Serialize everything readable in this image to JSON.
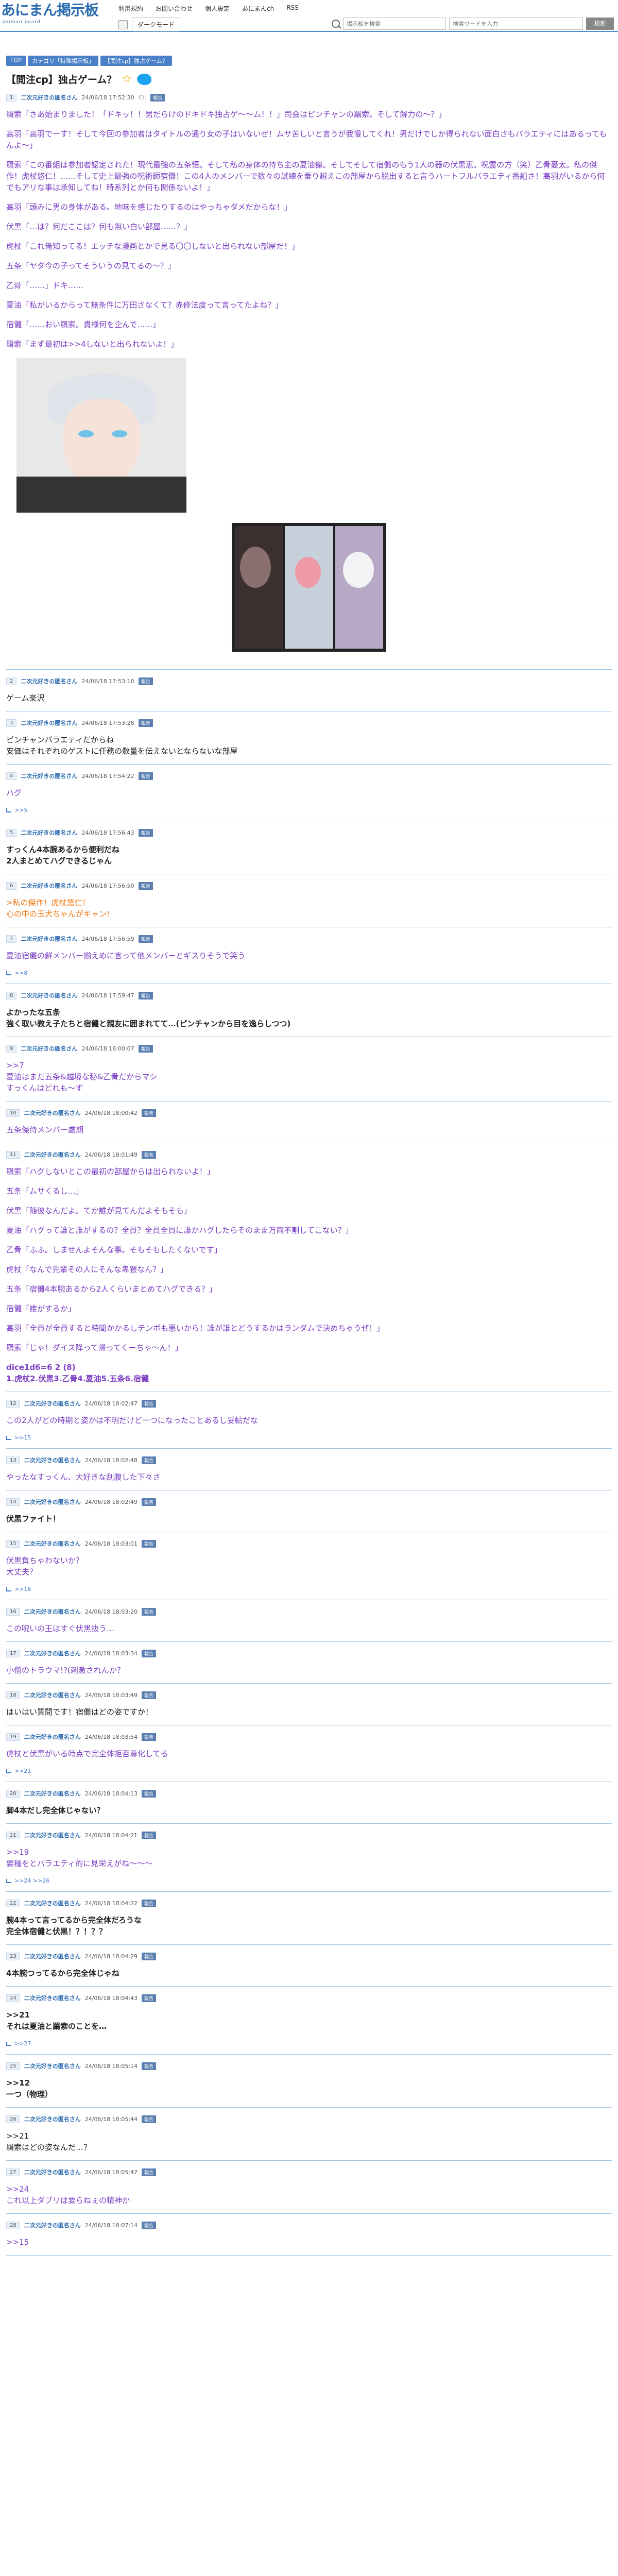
{
  "header": {
    "logo_text": "あにまん掲示板",
    "logo_sub": "animan board",
    "nav": [
      "利用規約",
      "お問い合わせ",
      "個人設定",
      "あにまんch",
      "RSS"
    ],
    "mode_label": "ダークモード",
    "search_placeholder": "掲示板を検索",
    "search_placeholder2": "検索ワードを入力",
    "search_button": "検索"
  },
  "breadcrumb": [
    "TOP",
    "カテゴリ「特殊掲示板」",
    "【閲注cp】独占ゲーム？"
  ],
  "article": {
    "title": "【閲注cp】独占ゲーム？"
  },
  "op": {
    "num": "1",
    "name": "二次元好きの匿名さん",
    "date": "24/06/18 17:52:30",
    "id": "ID:",
    "badge": "報告",
    "paragraphs": [
      "羂索「さあ始まりました！「ドキッ！！男だらけのドキドキ独占ゲ〜〜ム！！」司会はピンチャンの羂索。そして解力の〜？」",
      "高羽「高羽でーす！そして今回の参加者はタイトルの通り女の子はいないぜ！ムサ苦しいと言うが我慢してくれ！男だけでしか得られない面白さもバラエティにはあるってもんよ〜」",
      "羂索「この番組は参加者認定された！現代最強の五条悟。そして私の身体の持ち主の夏油傑。そしてそして宿儺のもう1人の器の伏黒恵。呪霊の方（笑）乙骨憂太。私の傑作！虎杖悠仁！……そして史上最強の呪術師宿儺！この4人のメンバーで数々の試練を乗り越えこの部屋から脱出すると言うハートフルバラエティ番組さ！高羽がいるから何でもアリな事は承知してね！時系列とか何も関係ないよ！」",
      "高羽「頭みに男の身体がある。地味を感じたりするのはやっちゃダメだからな！」",
      "伏黒「…は？何だここは？何も無い白い部屋……？」",
      "虎杖「これ俺知ってる！エッチな漫画とかで見る〇〇しないと出られない部屋だ！」",
      "五条「ヤダ今の子ってそういうの見てるの〜？」",
      "乙骨「……」ドキ……",
      "夏油「私がいるからって無条件に万田さなくて？赤修法度って言ってたよね？」",
      "宿儺「……おい羂索。貴様何を企んで……」",
      "羂索「まず最初は>>4しないと出られないよ！」"
    ]
  },
  "posts": [
    {
      "num": "2",
      "name": "二次元好きの匿名さん",
      "date": "24/06/18 17:53:10",
      "badge": "報告",
      "lines": [
        "ゲーム楽沢"
      ],
      "style": "black-plain"
    },
    {
      "num": "3",
      "name": "二次元好きの匿名さん",
      "date": "24/06/18 17:53:28",
      "badge": "報告",
      "lines": [
        "ピンチャンバラエティだからね",
        "安価はそれぞれのゲストに任務の数量を伝えないとならないな部屋"
      ],
      "style": "black-plain"
    },
    {
      "num": "4",
      "name": "二次元好きの匿名さん",
      "date": "24/06/18 17:54:22",
      "badge": "報告",
      "lines": [
        "ハグ"
      ],
      "style": "purple",
      "replies": ">>5"
    },
    {
      "num": "5",
      "name": "二次元好きの匿名さん",
      "date": "24/06/18 17:56:43",
      "badge": "報告",
      "lines": [
        "すっくん4本腕あるから便利だね",
        "2人まとめてハグできるじゃん"
      ],
      "style": "black-bold"
    },
    {
      "num": "6",
      "name": "二次元好きの匿名さん",
      "date": "24/06/18 17:56:50",
      "badge": "報告",
      "lines": [
        ">私の傑作！虎杖悠仁！",
        "心の中の玉犬ちゃんがキャン!"
      ],
      "style": "orange"
    },
    {
      "num": "7",
      "name": "二次元好きの匿名さん",
      "date": "24/06/18 17:56:59",
      "badge": "報告",
      "lines": [
        "夏油宿儺の鮮メンバー揃えめに言って他メンバーとギスりそうで笑う"
      ],
      "style": "purple",
      "replies": ">>8"
    },
    {
      "num": "8",
      "name": "二次元好きの匿名さん",
      "date": "24/06/18 17:59:47",
      "badge": "報告",
      "lines": [
        "よかったな五条",
        "強く取い教え子たちと宿儺と親友に囲まれてて…(ピンチャンから目を逸らしつつ)"
      ],
      "style": "black-bold"
    },
    {
      "num": "9",
      "name": "二次元好きの匿名さん",
      "date": "24/06/18 18:00:07",
      "badge": "報告",
      "lines": [
        ">>7",
        "夏油はまだ五条&越境な秘&乙骨だからマシ",
        "すっくんはどれも〜ず"
      ],
      "style": "purple"
    },
    {
      "num": "10",
      "name": "二次元好きの匿名さん",
      "date": "24/06/18 18:00:42",
      "badge": "報告",
      "lines": [
        "五条傑侍メンバー處期"
      ],
      "style": "purple"
    },
    {
      "num": "11",
      "name": "二次元好きの匿名さん",
      "date": "24/06/18 18:01:49",
      "badge": "報告",
      "lines": [
        "羂索「ハグしないとこの最初の部屋からは出られないよ！」",
        "五条「ムサくるし…」",
        "伏黒「随彼なんだよ。てか誰が見てんだよそもそも」",
        "夏油「ハグって誰と誰がするの？全員？全員全員に誰かハグしたらそのまま万両不割してこない？」",
        "乙骨「ふふ。しませんよそんな事。そもそもしたくないです」",
        "虎杖「なんで先輩その人にそんな卑猥なん？」",
        "五条「宿儺4本腕あるから2人くらいまとめてハグできる？」",
        "宿儺「誰がするか」",
        "高羽「全員が全員すると時間かかるしテンポも悪いから！誰が誰とどうするかはランダムで決めちゃうぜ！」",
        "羂索「じゃ！ダイス降って帰ってくーちゃ〜ん！」"
      ],
      "style": "purple-paras",
      "dice_label": "dice1d6=6 2 (8)",
      "dice_result": "1.虎杖2.伏黒3.乙骨4.夏油5.五条6.宿儺"
    },
    {
      "num": "12",
      "name": "二次元好きの匿名さん",
      "date": "24/06/18 18:02:47",
      "badge": "報告",
      "lines": [
        "この2人がどの時期と姿かは不明だけどーつになったことあるし妥帖だな"
      ],
      "style": "purple",
      "replies": ">>15"
    },
    {
      "num": "13",
      "name": "二次元好きの匿名さん",
      "date": "24/06/18 18:02:48",
      "badge": "報告",
      "lines": [
        "やったなすっくん、大好きな刮腹した下々さ"
      ],
      "style": "purple"
    },
    {
      "num": "14",
      "name": "二次元好きの匿名さん",
      "date": "24/06/18 18:02:49",
      "badge": "報告",
      "lines": [
        "伏黒ファイト！"
      ],
      "style": "black-bold"
    },
    {
      "num": "15",
      "name": "二次元好きの匿名さん",
      "date": "24/06/18 18:03:01",
      "badge": "報告",
      "lines": [
        "伏黒負ちゃわないか？",
        "大丈夫？"
      ],
      "style": "purple",
      "replies": ">>16"
    },
    {
      "num": "16",
      "name": "二次元好きの匿名さん",
      "date": "24/06/18 18:03:20",
      "badge": "報告",
      "lines": [
        "この呪いの王はすぐ伏黒抜う…"
      ],
      "style": "purple"
    },
    {
      "num": "17",
      "name": "二次元好きの匿名さん",
      "date": "24/06/18 18:03:34",
      "badge": "報告",
      "lines": [
        "小僧のトラウマ!?(刺激されんか？"
      ],
      "style": "purple"
    },
    {
      "num": "18",
      "name": "二次元好きの匿名さん",
      "date": "24/06/18 18:03:49",
      "badge": "報告",
      "lines": [
        "はいはい質問です！宿儺はどの姿ですか！"
      ],
      "style": "black-plain"
    },
    {
      "num": "19",
      "name": "二次元好きの匿名さん",
      "date": "24/06/18 18:03:54",
      "badge": "報告",
      "lines": [
        "虎杖と伏黒がいる時点で完全体拒否尊化してる"
      ],
      "style": "purple",
      "replies": ">>21"
    },
    {
      "num": "20",
      "name": "二次元好きの匿名さん",
      "date": "24/06/18 18:04:13",
      "badge": "報告",
      "lines": [
        "脚4本だし完全体じゃない？"
      ],
      "style": "black-bold"
    },
    {
      "num": "21",
      "name": "二次元好きの匿名さん",
      "date": "24/06/18 18:04:21",
      "badge": "報告",
      "lines": [
        ">>19",
        "要種をとバラエティ的に見栄えがね〜〜〜"
      ],
      "style": "purple",
      "replies": ">>24 >>26"
    },
    {
      "num": "22",
      "name": "二次元好きの匿名さん",
      "date": "24/06/18 18:04:22",
      "badge": "報告",
      "lines": [
        "腕4本って言ってるから完全体だろうな",
        "完全体宿儺と伏黒！？！？？"
      ],
      "style": "black-bold"
    },
    {
      "num": "23",
      "name": "二次元好きの匿名さん",
      "date": "24/06/18 18:04:29",
      "badge": "報告",
      "lines": [
        "4本腕つってるから完全体じゃね"
      ],
      "style": "black-bold"
    },
    {
      "num": "24",
      "name": "二次元好きの匿名さん",
      "date": "24/06/18 18:04:43",
      "badge": "報告",
      "lines": [
        ">>21",
        "それは夏油と羂索のことを…"
      ],
      "style": "black-bold",
      "replies": ">>27"
    },
    {
      "num": "25",
      "name": "二次元好きの匿名さん",
      "date": "24/06/18 18:05:14",
      "badge": "報告",
      "lines": [
        ">>12",
        "一つ（物理）"
      ],
      "style": "black-bold"
    },
    {
      "num": "26",
      "name": "二次元好きの匿名さん",
      "date": "24/06/18 18:05:44",
      "badge": "報告",
      "lines": [
        ">>21",
        "羂索はどの姿なんだ…？"
      ],
      "style": "black-plain"
    },
    {
      "num": "27",
      "name": "二次元好きの匿名さん",
      "date": "24/06/18 18:05:47",
      "badge": "報告",
      "lines": [
        ">>24",
        "これ以上ダブリは要らねぇの精神か"
      ],
      "style": "purple"
    }
  ],
  "last_post": {
    "num": "28",
    "name": "二次元好きの匿名さん",
    "date": "24/06/18 18:07:14",
    "badge": "報告",
    "lines": [
      ">>15"
    ],
    "style": "purple"
  },
  "colors": {
    "accent": "#2b6cb0",
    "purple_text": "#7b3fc4",
    "orange_text": "#f07a12",
    "divider": "#9cc6e8"
  }
}
